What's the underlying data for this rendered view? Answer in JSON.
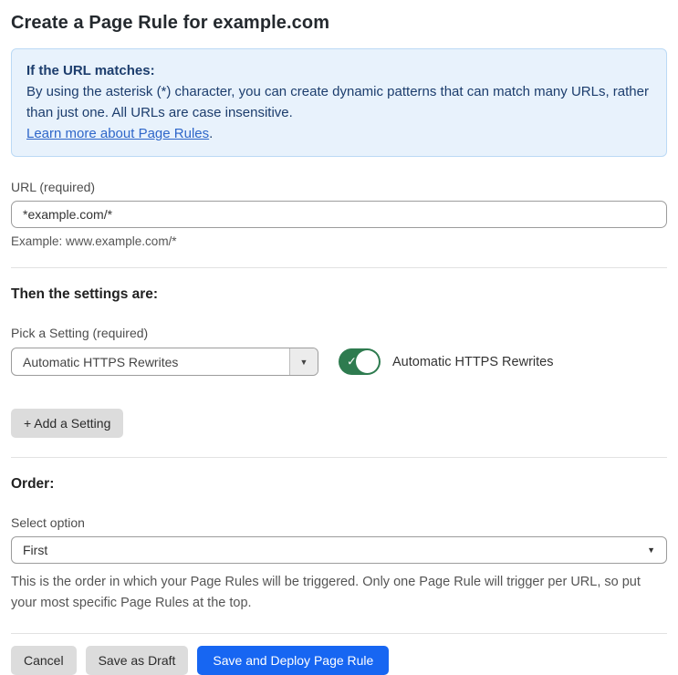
{
  "page": {
    "title": "Create a Page Rule for example.com"
  },
  "info_box": {
    "heading": "If the URL matches:",
    "body": "By using the asterisk (*) character, you can create dynamic patterns that can match many URLs, rather than just one. All URLs are case insensitive.",
    "link_text": "Learn more about Page Rules",
    "link_suffix": "."
  },
  "url_field": {
    "label": "URL (required)",
    "value": "*example.com/*",
    "helper": "Example: www.example.com/*"
  },
  "settings_section": {
    "heading": "Then the settings are:",
    "picker_label": "Pick a Setting (required)",
    "picker_value": "Automatic HTTPS Rewrites",
    "toggle_label": "Automatic HTTPS Rewrites",
    "toggle_state": "on",
    "add_setting_button": "+ Add a Setting"
  },
  "order_section": {
    "heading": "Order:",
    "select_label": "Select option",
    "select_value": "First",
    "description": "This is the order in which your Page Rules will be triggered. Only one Page Rule will trigger per URL, so put your most specific Page Rules at the top."
  },
  "footer": {
    "cancel_label": "Cancel",
    "save_draft_label": "Save as Draft",
    "save_deploy_label": "Save and Deploy Page Rule"
  },
  "icons": {
    "dropdown_arrow": "▼",
    "select_arrow": "▼",
    "toggle_check": "✓"
  },
  "colors": {
    "info_bg": "#e8f2fc",
    "info_border": "#bcdaf5",
    "info_text": "#1c3d6d",
    "link_blue": "#2e66c9",
    "toggle_on_green": "#2e7b4f",
    "primary_button_blue": "#1766f2",
    "gray_button": "#dcdcdc"
  }
}
